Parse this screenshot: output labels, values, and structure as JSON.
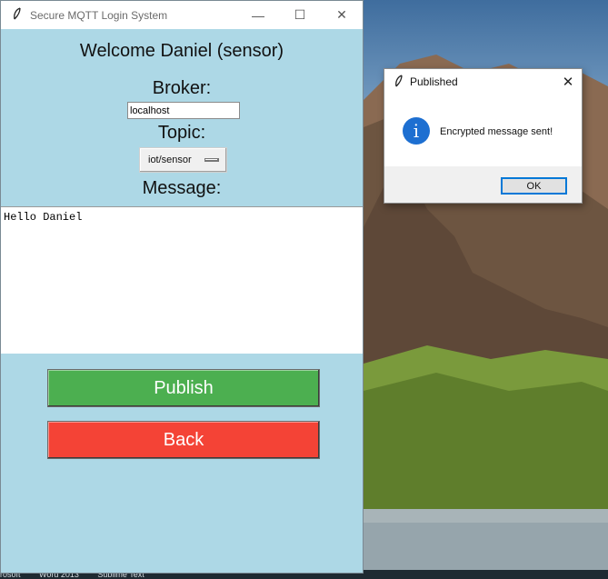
{
  "main_window": {
    "title": "Secure MQTT Login System",
    "controls": {
      "minimize": "—",
      "maximize": "☐",
      "close": "✕"
    },
    "welcome": "Welcome Daniel (sensor)",
    "broker": {
      "label": "Broker:",
      "value": "localhost"
    },
    "topic": {
      "label": "Topic:",
      "selected": "iot/sensor"
    },
    "message": {
      "label": "Message:",
      "text": "Hello Daniel"
    },
    "buttons": {
      "publish": "Publish",
      "back": "Back"
    },
    "colors": {
      "background": "#add8e6",
      "publish": "#4caf50",
      "back": "#f44336"
    }
  },
  "dialog": {
    "title": "Published",
    "close": "✕",
    "icon": "info-icon",
    "icon_glyph": "i",
    "message": "Encrypted message sent!",
    "ok_label": "OK"
  },
  "taskbar": {
    "items": [
      "rosoft",
      "Word 2013",
      "Sublime Text"
    ]
  }
}
